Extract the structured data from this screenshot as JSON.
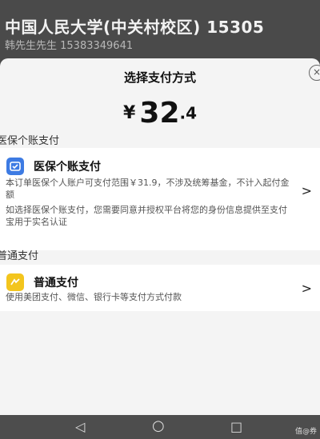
{
  "background": {
    "title": "中国人民大学(中关村校区) 15305",
    "subtitle": "韩先生先生 15383349641"
  },
  "sheet": {
    "title": "选择支付方式",
    "close_label": "×",
    "amount": {
      "currency": "¥",
      "integer": "32",
      "decimal": ".4"
    }
  },
  "medical": {
    "section_label": "医保个账支付",
    "name": "医保个账支付",
    "desc1": "本订单医保个人账户可支付范围￥31.9，不涉及统筹基金，不计入起付金额",
    "desc2": "如选择医保个账支付，您需要同意并授权平台将您的身份信息提供至支付宝用于实名认证",
    "chevron": ">"
  },
  "ordinary": {
    "section_label": "普通支付",
    "name": "普通支付",
    "desc": "使用美团支付、微信、银行卡等支付方式付款",
    "chevron": ">"
  },
  "navbar": {
    "back": "◁",
    "home": "○",
    "recent": "□",
    "watermark": "值@券"
  },
  "colors": {
    "medical_icon": "#3d7be3",
    "ordinary_icon": "#f3c51d"
  }
}
